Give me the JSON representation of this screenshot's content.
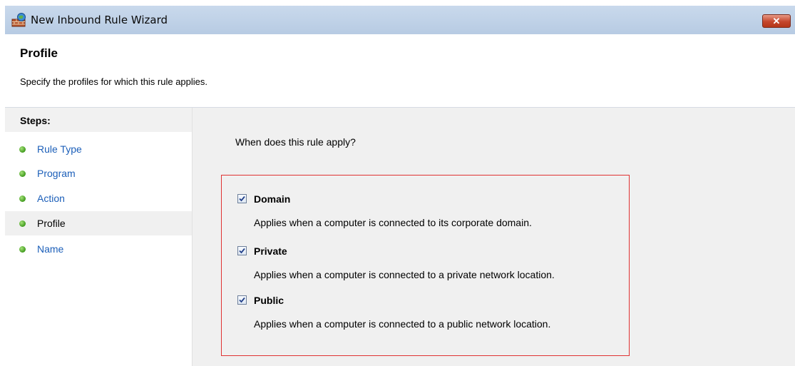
{
  "window": {
    "title": "New Inbound Rule Wizard",
    "close_glyph": "✕",
    "icon": "firewall-icon"
  },
  "header": {
    "title": "Profile",
    "description": "Specify the profiles for which this rule applies."
  },
  "steps": {
    "heading": "Steps:",
    "items": [
      {
        "label": "Rule Type"
      },
      {
        "label": "Program"
      },
      {
        "label": "Action"
      },
      {
        "label": "Profile"
      },
      {
        "label": "Name"
      }
    ],
    "current_index": 3
  },
  "content": {
    "question": "When does this rule apply?",
    "options": [
      {
        "label": "Domain",
        "description": "Applies when a computer is connected to its corporate domain.",
        "checked": true
      },
      {
        "label": "Private",
        "description": "Applies when a computer is connected to a private network location.",
        "checked": true
      },
      {
        "label": "Public",
        "description": "Applies when a computer is connected to a public network location.",
        "checked": true
      }
    ]
  },
  "colors": {
    "highlight_border": "#e03232",
    "link": "#1c5fb9",
    "step_dot": "#3f9a1d"
  }
}
